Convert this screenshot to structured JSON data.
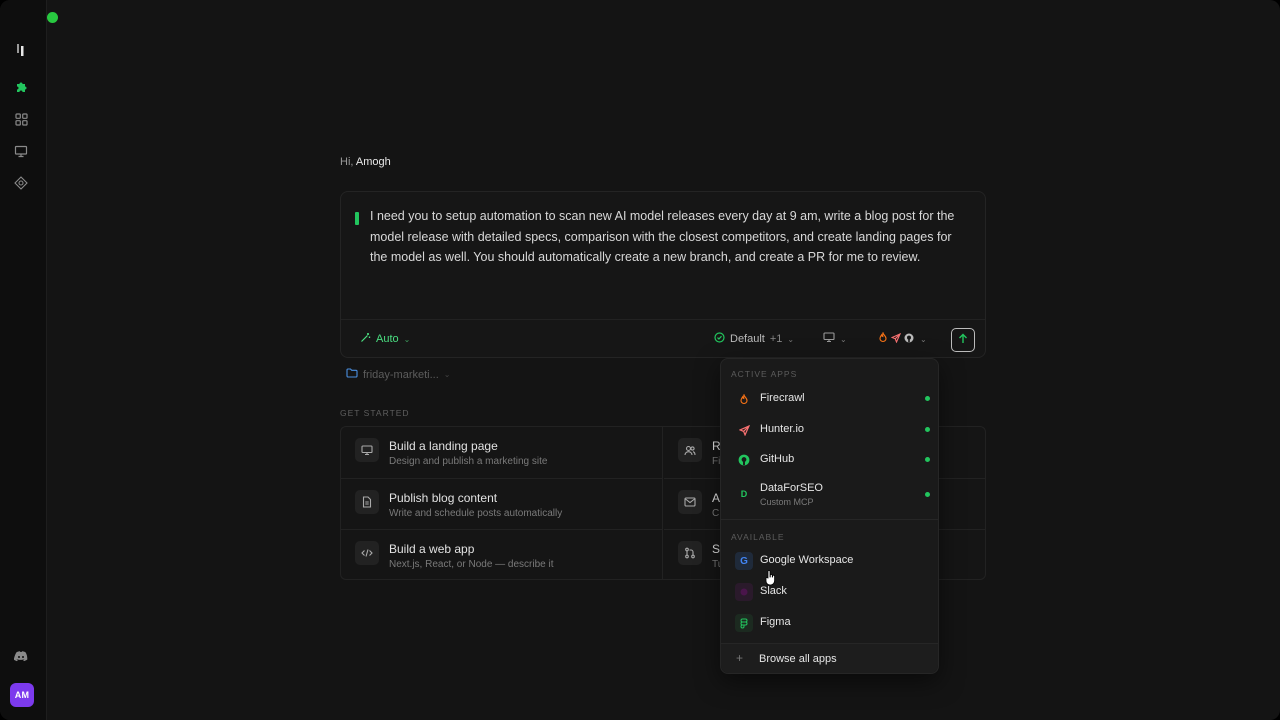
{
  "window": {
    "traffic_lights": [
      "close",
      "minimize",
      "maximize"
    ]
  },
  "sidebar": {
    "icons": [
      "logo-icon",
      "puzzle-icon",
      "grid-icon",
      "presentation-icon",
      "radar-icon",
      "discord-icon"
    ],
    "avatar_initials": "AM",
    "avatar_color": "#7c3aed",
    "accent_color": "#22c55e"
  },
  "greeting": {
    "prefix": "Hi,",
    "name": "Amogh"
  },
  "composer": {
    "prompt": "I need you to setup automation to scan new AI model releases every day at 9 am, write a blog post for the model release with detailed specs, comparison with the closest competitors, and create landing pages for the model as well. You should automatically create a new branch, and create a PR for me to review.",
    "mode_label": "Auto",
    "profile_label": "Default",
    "profile_extra": "+1"
  },
  "folder": {
    "name": "friday-marketi..."
  },
  "get_started": {
    "label": "GET STARTED",
    "cards": [
      {
        "title": "Build a landing page",
        "subtitle": "Design and publish a marketing site",
        "icon": "monitor-icon"
      },
      {
        "title": "R",
        "subtitle": "Fi",
        "icon": "users-icon"
      },
      {
        "title": "Publish blog content",
        "subtitle": "Write and schedule posts automatically",
        "icon": "document-icon"
      },
      {
        "title": "A",
        "subtitle": "C",
        "icon": "mail-icon"
      },
      {
        "title": "Build a web app",
        "subtitle": "Next.js, React, or Node — describe it",
        "icon": "code-icon"
      },
      {
        "title": "S",
        "subtitle": "Tu",
        "icon": "git-pr-icon"
      }
    ]
  },
  "apps_dropdown": {
    "active_label": "ACTIVE APPS",
    "active": [
      {
        "name": "Firecrawl",
        "icon": "firecrawl-icon",
        "color": "#f97316"
      },
      {
        "name": "Hunter.io",
        "icon": "send-icon",
        "color": "#f87171"
      },
      {
        "name": "GitHub",
        "icon": "github-icon",
        "color": "#22c55e"
      },
      {
        "name": "DataForSEO",
        "sub": "Custom MCP",
        "icon": "letter-d-icon",
        "icon_text": "D",
        "color": "#22c55e"
      }
    ],
    "available_label": "AVAILABLE",
    "available": [
      {
        "name": "Google Workspace",
        "icon": "google-icon",
        "icon_text": "G",
        "color": "#4285f4"
      },
      {
        "name": "Slack",
        "icon": "slack-icon",
        "color": "#4a154b"
      },
      {
        "name": "Figma",
        "icon": "figma-icon",
        "color": "#22c55e"
      }
    ],
    "browse_label": "Browse all apps"
  }
}
